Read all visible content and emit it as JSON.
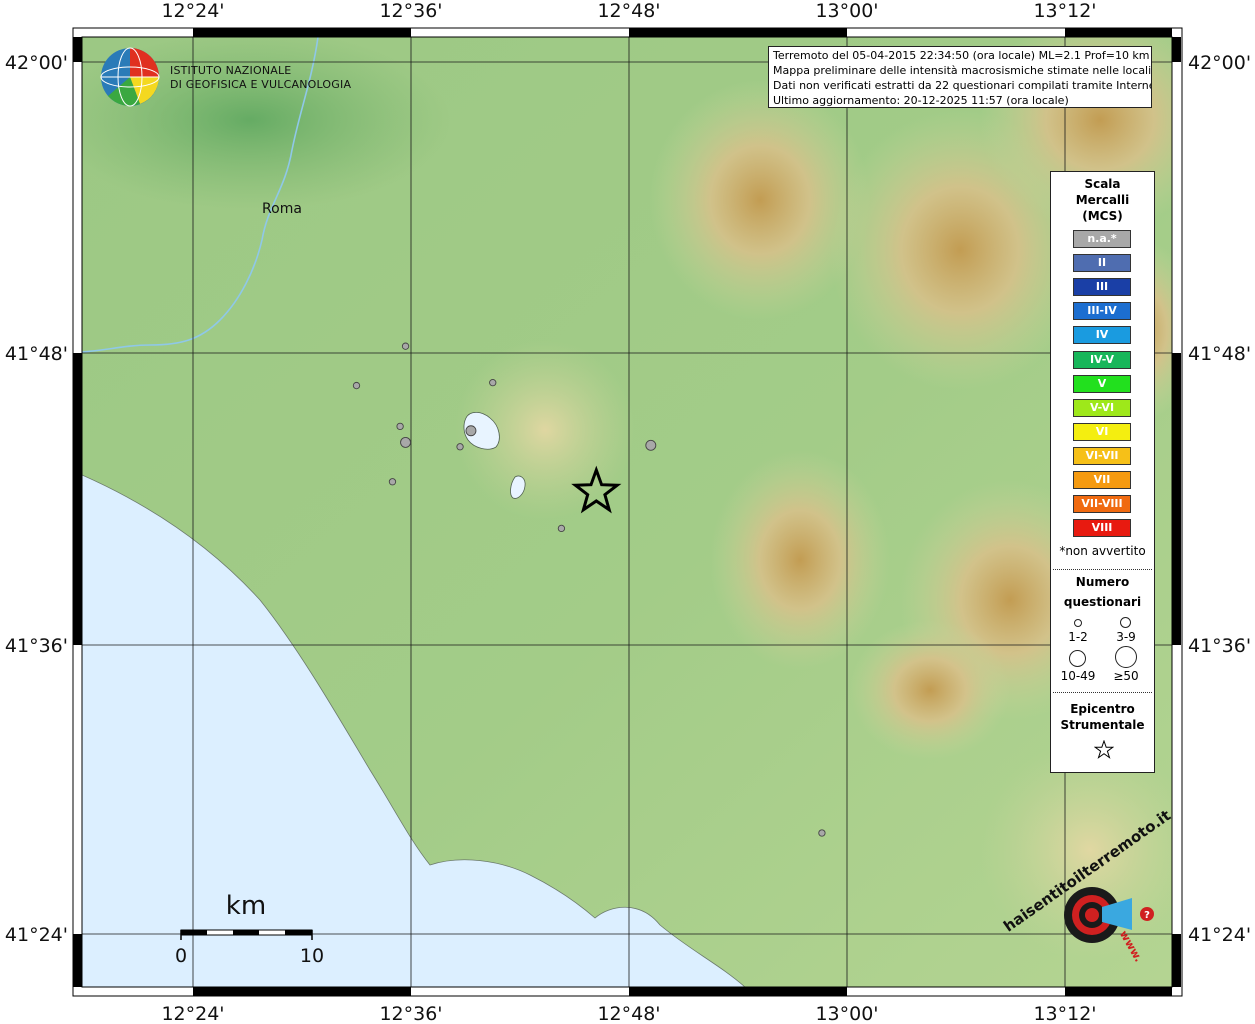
{
  "map": {
    "lon_ticks": [
      "12°24'",
      "12°36'",
      "12°48'",
      "13°00'",
      "13°12'"
    ],
    "lat_ticks": [
      "42°00'",
      "41°48'",
      "41°36'",
      "41°24'"
    ],
    "city_label": "Roma",
    "scale_bar": {
      "unit": "km",
      "min_label": "0",
      "max_label": "10"
    }
  },
  "logo": {
    "line1": "ISTITUTO NAZIONALE",
    "line2": "DI GEOFISICA E VULCANOLOGIA"
  },
  "info": {
    "line1": "Terremoto del 05-04-2015 22:34:50 (ora locale) ML=2.1 Prof=10 km",
    "line2": "Mappa preliminare delle intensità macrosismiche stimate nelle località",
    "line3": "Dati non verificati estratti da 22 questionari compilati tramite Internet.",
    "line4": "Ultimo aggiornamento: 20-12-2025 11:57 (ora locale)"
  },
  "legend": {
    "title1": "Scala",
    "title2": "Mercalli",
    "title3": "(MCS)",
    "scale": [
      {
        "label": "n.a.*",
        "color": "#a8a8a8"
      },
      {
        "label": "II",
        "color": "#4f6db0"
      },
      {
        "label": "III",
        "color": "#1a3fa6"
      },
      {
        "label": "III-IV",
        "color": "#1c6ed0"
      },
      {
        "label": "IV",
        "color": "#1a9be0"
      },
      {
        "label": "IV-V",
        "color": "#18b65a"
      },
      {
        "label": "V",
        "color": "#22e01e"
      },
      {
        "label": "V-VI",
        "color": "#9ee81a"
      },
      {
        "label": "VI",
        "color": "#f4ee10"
      },
      {
        "label": "VI-VII",
        "color": "#f6c018"
      },
      {
        "label": "VII",
        "color": "#f59a10"
      },
      {
        "label": "VII-VIII",
        "color": "#f06a10"
      },
      {
        "label": "VIII",
        "color": "#e81a10"
      }
    ],
    "note": "*non avvertito",
    "count_title1": "Numero",
    "count_title2": "questionari",
    "counts": [
      "1-2",
      "3-9",
      "10-49",
      "≥50"
    ],
    "epicenter_title1": "Epicentro",
    "epicenter_title2": "Strumentale"
  },
  "points": [
    {
      "lon": 12.595,
      "lat": 41.805,
      "size": "1-2"
    },
    {
      "lon": 12.55,
      "lat": 41.778,
      "size": "1-2"
    },
    {
      "lon": 12.675,
      "lat": 41.78,
      "size": "1-2"
    },
    {
      "lon": 12.59,
      "lat": 41.75,
      "size": "1-2"
    },
    {
      "lon": 12.655,
      "lat": 41.747,
      "size": "3-9"
    },
    {
      "lon": 12.595,
      "lat": 41.739,
      "size": "3-9"
    },
    {
      "lon": 12.645,
      "lat": 41.736,
      "size": "1-2"
    },
    {
      "lon": 12.82,
      "lat": 41.737,
      "size": "3-9"
    },
    {
      "lon": 12.583,
      "lat": 41.712,
      "size": "1-2"
    },
    {
      "lon": 12.738,
      "lat": 41.68,
      "size": "1-2"
    },
    {
      "lon": 12.977,
      "lat": 41.471,
      "size": "1-2"
    }
  ],
  "epicenter": {
    "lon": 12.77,
    "lat": 41.705
  },
  "colors": {
    "sea": "#dcefff",
    "lowland": "#9cc884",
    "point_fill": "#a8a8a8",
    "frame": "#000000"
  },
  "branding": {
    "site_text": "haisentitoilterremoto.it",
    "www_text": "www."
  }
}
